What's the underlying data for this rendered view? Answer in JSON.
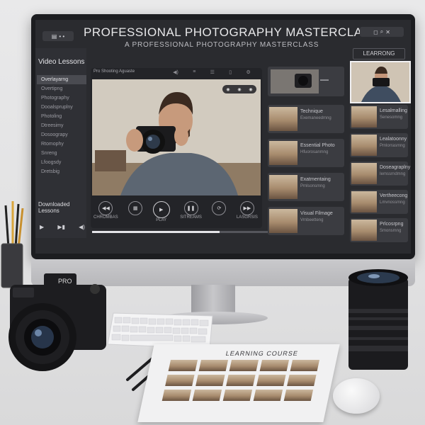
{
  "app": {
    "title": "PROFESSIONAL PHOTOGRAPHY MASTERCLASS",
    "subtitle": "A PROFESSIONAL PHOTOGRAPHY MASTERCLASS",
    "right_tab": "LEARRONG"
  },
  "sidebar": {
    "heading": "Video Lessons",
    "items": [
      "Overlayarng",
      "Overtipng",
      "Photography",
      "Dooalspruplny",
      "Photoling",
      "Dtreesimy",
      "Dosoograpy",
      "Rtomophy",
      "Snreng",
      "Lfoogsdy",
      "Dretsbig"
    ],
    "download_label": "Downloaded Lessons"
  },
  "player": {
    "top_label": "Pro Shooting Aguaste",
    "controls": [
      "CHROMBAS",
      "PLAY",
      "SITREAMS",
      "LASGRSIS"
    ],
    "progress": 0.62
  },
  "lessons_col1": [
    {
      "title": "Technique",
      "sub": "Exemaneedmng"
    },
    {
      "title": "Essential Photo",
      "sub": "Hfuorosanmng"
    },
    {
      "title": "Exatmentaing",
      "sub": "Pmlsonsmng"
    },
    {
      "title": "Visual Filmage",
      "sub": "Vrnbeetteng"
    }
  ],
  "lessons_col2": [
    {
      "title": "Lesalmalling",
      "sub": "Senesomng"
    },
    {
      "title": "Lealatoonny",
      "sub": "Pmlorrasmng"
    },
    {
      "title": "Doseagraplny",
      "sub": "Iemssrndmng"
    },
    {
      "title": "Vertheecong",
      "sub": "Lmvnossmng"
    },
    {
      "title": "Prlcosrpng",
      "sub": "Smonsmng"
    }
  ],
  "desk": {
    "booklet_title": "LEARNING COURSE",
    "camera_brand": "PRO"
  }
}
